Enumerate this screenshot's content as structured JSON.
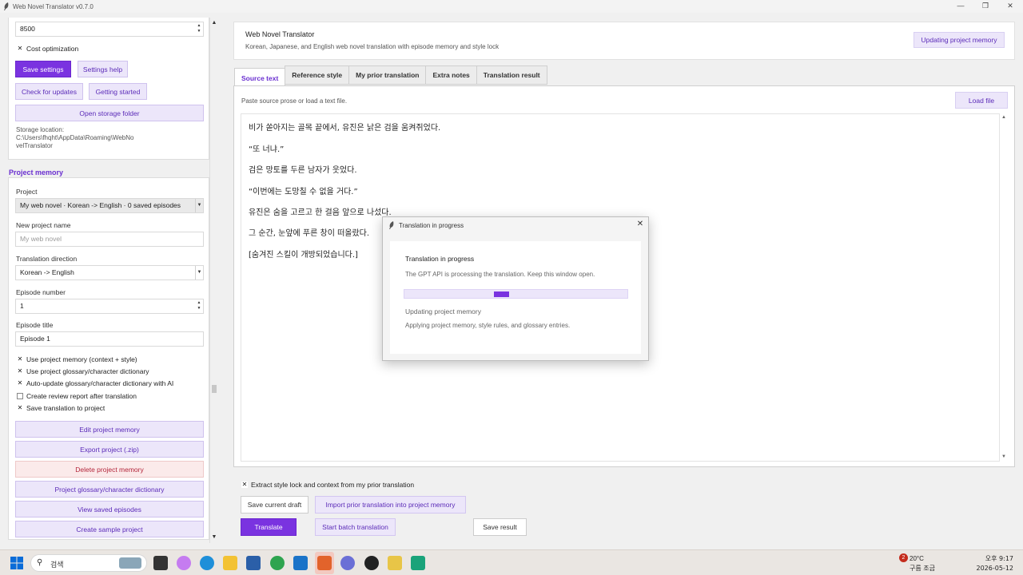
{
  "window": {
    "title": "Web Novel Translator v0.7.0"
  },
  "settings": {
    "max_tokens_value": "8500",
    "cost_optimization_label": "Cost optimization",
    "save_settings": "Save settings",
    "settings_help": "Settings help",
    "check_updates": "Check for updates",
    "getting_started": "Getting started",
    "open_storage": "Open storage folder",
    "storage_label": "Storage location:",
    "storage_path_1": "C:\\Users\\fhqht\\AppData\\Roaming\\WebNo",
    "storage_path_2": "velTranslator"
  },
  "project_memory": {
    "section_title": "Project memory",
    "project_label": "Project",
    "project_value": "My web novel · Korean -> English · 0 saved episodes",
    "new_project_label": "New project name",
    "new_project_placeholder": "My web novel",
    "direction_label": "Translation direction",
    "direction_value": "Korean -> English",
    "episode_number_label": "Episode number",
    "episode_number_value": "1",
    "episode_title_label": "Episode title",
    "episode_title_value": "Episode 1",
    "checks": [
      {
        "label": "Use project memory (context + style)",
        "checked": true
      },
      {
        "label": "Use project glossary/character dictionary",
        "checked": true
      },
      {
        "label": "Auto-update glossary/character dictionary with AI",
        "checked": true
      },
      {
        "label": "Create review report after translation",
        "checked": false
      },
      {
        "label": "Save translation to project",
        "checked": true
      }
    ],
    "buttons": {
      "edit": "Edit project memory",
      "export": "Export project (.zip)",
      "delete": "Delete project memory",
      "glossary": "Project glossary/character dictionary",
      "saved_episodes": "View saved episodes",
      "sample": "Create sample project"
    }
  },
  "header": {
    "title": "Web Novel Translator",
    "subtitle": "Korean, Japanese, and English web novel translation with episode memory and style lock",
    "status_button": "Updating project memory"
  },
  "tabs": [
    "Source text",
    "Reference style",
    "My prior translation",
    "Extra notes",
    "Translation result"
  ],
  "editor": {
    "hint": "Paste source prose or load a text file.",
    "load_file": "Load file",
    "lines": [
      "비가 쏟아지는 골목 끝에서, 유진은 낡은 검을 움켜쥐었다.",
      "“또 너냐.”",
      "검은 망토를 두른 남자가 웃었다.",
      "“이번에는 도망칠 수 없을 거다.”",
      "유진은 숨을 고르고 한 걸음 앞으로 나섰다.",
      "그 순간, 눈앞에 푸른 창이 떠올랐다.",
      "[숨겨진 스킬이 개방되었습니다.]"
    ]
  },
  "bottom": {
    "extract_label": "Extract style lock and context from my prior translation",
    "save_draft": "Save current draft",
    "import_prior": "Import prior translation into project memory",
    "translate": "Translate",
    "batch": "Start batch translation",
    "save_result": "Save result"
  },
  "modal": {
    "window_title": "Translation in progress",
    "title": "Translation in progress",
    "description": "The GPT API is processing the translation. Keep this window open.",
    "stage": "Updating project memory",
    "detail": "Applying project memory, style rules, and glossary entries."
  },
  "taskbar": {
    "search_placeholder": "검색",
    "weather_temp": "20°C",
    "weather_cond": "구름 조금",
    "notification_count": "2",
    "time": "오후 9:17",
    "date": "2026-05-12"
  },
  "colors": {
    "accent": "#7a33e0",
    "accent_light": "#ece6fa",
    "danger": "#b3263b"
  }
}
